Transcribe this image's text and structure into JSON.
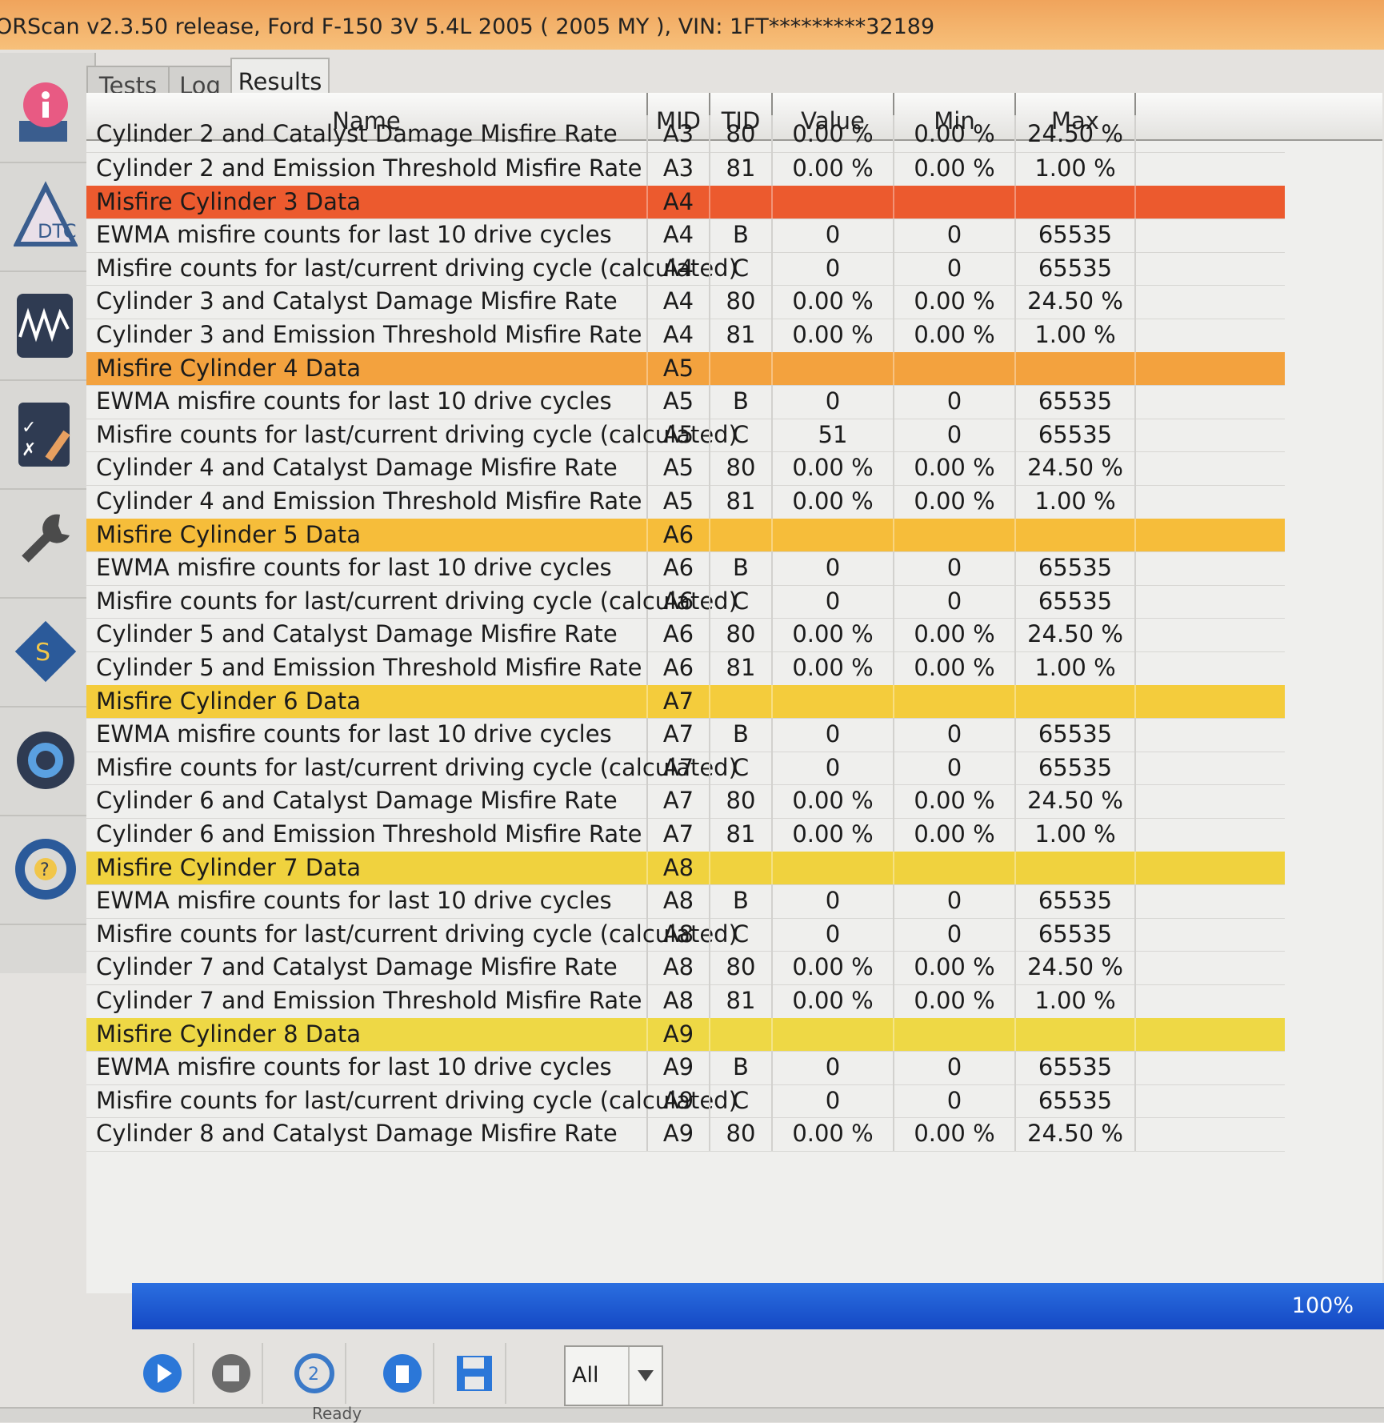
{
  "window": {
    "title": "ORScan v2.3.50 release, Ford F-150 3V 5.4L 2005 ( 2005 MY ), VIN: 1FT*********32189"
  },
  "sidebar": {
    "items": [
      "info-icon",
      "dtc-icon",
      "oscilloscope-icon",
      "checklist-icon",
      "wrench-icon",
      "module-chip-icon",
      "settings-gear-icon",
      "help-icon"
    ]
  },
  "tabs": [
    {
      "label": "Tests"
    },
    {
      "label": "Log"
    },
    {
      "label": "Results",
      "active": true
    }
  ],
  "table": {
    "columns": [
      "Name",
      "MID",
      "TID",
      "Value",
      "Min",
      "Max"
    ],
    "partial_row": {
      "name": "Cylinder 2 and Catalyst Damage Misfire Rate",
      "mid": "A3",
      "tid": "80",
      "value": "0.00 %",
      "min": "0.00 %",
      "max": "24.50 %"
    },
    "rows": [
      {
        "name": "Cylinder 2 and Emission Threshold Misfire Rate",
        "mid": "A3",
        "tid": "81",
        "value": "0.00 %",
        "min": "0.00 %",
        "max": "1.00 %"
      },
      {
        "name": "Misfire Cylinder 3 Data",
        "mid": "A4",
        "group": true,
        "color": "#ec5a2e"
      },
      {
        "name": "EWMA misfire counts for last 10 drive cycles",
        "mid": "A4",
        "tid": "B",
        "value": "0",
        "min": "0",
        "max": "65535"
      },
      {
        "name": "Misfire counts for last/current driving cycle (calculated)",
        "mid": "A4",
        "tid": "C",
        "value": "0",
        "min": "0",
        "max": "65535"
      },
      {
        "name": "Cylinder 3 and Catalyst Damage Misfire Rate",
        "mid": "A4",
        "tid": "80",
        "value": "0.00 %",
        "min": "0.00 %",
        "max": "24.50 %"
      },
      {
        "name": "Cylinder 3 and Emission Threshold Misfire Rate",
        "mid": "A4",
        "tid": "81",
        "value": "0.00 %",
        "min": "0.00 %",
        "max": "1.00 %"
      },
      {
        "name": "Misfire Cylinder 4 Data",
        "mid": "A5",
        "group": true,
        "color": "#f3a23e"
      },
      {
        "name": "EWMA misfire counts for last 10 drive cycles",
        "mid": "A5",
        "tid": "B",
        "value": "0",
        "min": "0",
        "max": "65535"
      },
      {
        "name": "Misfire counts for last/current driving cycle (calculated)",
        "mid": "A5",
        "tid": "C",
        "value": "51",
        "min": "0",
        "max": "65535"
      },
      {
        "name": "Cylinder 4 and Catalyst Damage Misfire Rate",
        "mid": "A5",
        "tid": "80",
        "value": "0.00 %",
        "min": "0.00 %",
        "max": "24.50 %"
      },
      {
        "name": "Cylinder 4 and Emission Threshold Misfire Rate",
        "mid": "A5",
        "tid": "81",
        "value": "0.00 %",
        "min": "0.00 %",
        "max": "1.00 %"
      },
      {
        "name": "Misfire Cylinder 5 Data",
        "mid": "A6",
        "group": true,
        "color": "#f6bd3a"
      },
      {
        "name": "EWMA misfire counts for last 10 drive cycles",
        "mid": "A6",
        "tid": "B",
        "value": "0",
        "min": "0",
        "max": "65535"
      },
      {
        "name": "Misfire counts for last/current driving cycle (calculated)",
        "mid": "A6",
        "tid": "C",
        "value": "0",
        "min": "0",
        "max": "65535"
      },
      {
        "name": "Cylinder 5 and Catalyst Damage Misfire Rate",
        "mid": "A6",
        "tid": "80",
        "value": "0.00 %",
        "min": "0.00 %",
        "max": "24.50 %"
      },
      {
        "name": "Cylinder 5 and Emission Threshold Misfire Rate",
        "mid": "A6",
        "tid": "81",
        "value": "0.00 %",
        "min": "0.00 %",
        "max": "1.00 %"
      },
      {
        "name": "Misfire Cylinder 6 Data",
        "mid": "A7",
        "group": true,
        "color": "#f4cc3c"
      },
      {
        "name": "EWMA misfire counts for last 10 drive cycles",
        "mid": "A7",
        "tid": "B",
        "value": "0",
        "min": "0",
        "max": "65535"
      },
      {
        "name": "Misfire counts for last/current driving cycle (calculated)",
        "mid": "A7",
        "tid": "C",
        "value": "0",
        "min": "0",
        "max": "65535"
      },
      {
        "name": "Cylinder 6 and Catalyst Damage Misfire Rate",
        "mid": "A7",
        "tid": "80",
        "value": "0.00 %",
        "min": "0.00 %",
        "max": "24.50 %"
      },
      {
        "name": "Cylinder 6 and Emission Threshold Misfire Rate",
        "mid": "A7",
        "tid": "81",
        "value": "0.00 %",
        "min": "0.00 %",
        "max": "1.00 %"
      },
      {
        "name": "Misfire Cylinder 7 Data",
        "mid": "A8",
        "group": true,
        "color": "#f0d23e"
      },
      {
        "name": "EWMA misfire counts for last 10 drive cycles",
        "mid": "A8",
        "tid": "B",
        "value": "0",
        "min": "0",
        "max": "65535"
      },
      {
        "name": "Misfire counts for last/current driving cycle (calculated)",
        "mid": "A8",
        "tid": "C",
        "value": "0",
        "min": "0",
        "max": "65535"
      },
      {
        "name": "Cylinder 7 and Catalyst Damage Misfire Rate",
        "mid": "A8",
        "tid": "80",
        "value": "0.00 %",
        "min": "0.00 %",
        "max": "24.50 %"
      },
      {
        "name": "Cylinder 7 and Emission Threshold Misfire Rate",
        "mid": "A8",
        "tid": "81",
        "value": "0.00 %",
        "min": "0.00 %",
        "max": "1.00 %"
      },
      {
        "name": "Misfire Cylinder 8 Data",
        "mid": "A9",
        "group": true,
        "color": "#eed845"
      },
      {
        "name": "EWMA misfire counts for last 10 drive cycles",
        "mid": "A9",
        "tid": "B",
        "value": "0",
        "min": "0",
        "max": "65535"
      },
      {
        "name": "Misfire counts for last/current driving cycle (calculated)",
        "mid": "A9",
        "tid": "C",
        "value": "0",
        "min": "0",
        "max": "65535"
      },
      {
        "name": "Cylinder 8 and Catalyst Damage Misfire Rate",
        "mid": "A9",
        "tid": "80",
        "value": "0.00 %",
        "min": "0.00 %",
        "max": "24.50 %"
      }
    ]
  },
  "progress": {
    "percent": 100,
    "label": "100%"
  },
  "toolbar": {
    "buttons": [
      "play-icon",
      "stop-icon",
      "reset-icon",
      "delete-icon",
      "save-icon"
    ],
    "filter_value": "All"
  },
  "status": {
    "text": "Ready"
  },
  "colors": {
    "progress": "#1f5bd6",
    "titlebar": "#f3b36a"
  }
}
